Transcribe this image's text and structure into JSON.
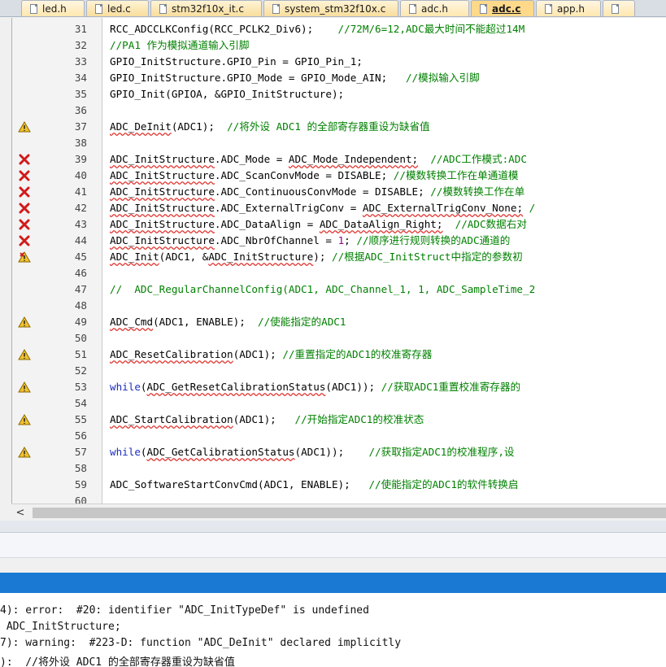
{
  "tabs": [
    {
      "label": "led.h",
      "kind": "header"
    },
    {
      "label": "led.c",
      "kind": "source"
    },
    {
      "label": "stm32f10x_it.c",
      "kind": "source"
    },
    {
      "label": "system_stm32f10x.c",
      "kind": "source"
    },
    {
      "label": "adc.h",
      "kind": "header"
    },
    {
      "label": "adc.c",
      "kind": "active"
    },
    {
      "label": "app.h",
      "kind": "header"
    },
    {
      "label": "",
      "kind": "header"
    }
  ],
  "editor": {
    "lines": [
      {
        "n": "31",
        "m": "",
        "segs": [
          [
            "RCC_ADCCLKConfig(RCC_PCLK2_Div6);    ",
            ""
          ],
          [
            "//72M/6=12,ADC最大时间不能超过14M",
            "cm"
          ]
        ]
      },
      {
        "n": "32",
        "m": "",
        "segs": [
          [
            "//PA1 作为模拟通道输入引脚",
            "cm"
          ]
        ]
      },
      {
        "n": "33",
        "m": "",
        "segs": [
          [
            "GPIO_InitStructure.GPIO_Pin = GPIO_Pin_1;",
            ""
          ]
        ]
      },
      {
        "n": "34",
        "m": "",
        "segs": [
          [
            "GPIO_InitStructure.GPIO_Mode = GPIO_Mode_AIN;   ",
            ""
          ],
          [
            "//模拟输入引脚",
            "cm"
          ]
        ]
      },
      {
        "n": "35",
        "m": "",
        "segs": [
          [
            "GPIO_Init(GPIOA, &GPIO_InitStructure);",
            ""
          ]
        ]
      },
      {
        "n": "36",
        "m": "",
        "segs": []
      },
      {
        "n": "37",
        "m": "warning",
        "segs": [
          [
            "ADC_DeInit",
            "sq"
          ],
          [
            "(ADC1);  ",
            ""
          ],
          [
            "//将外设 ADC1 的全部寄存器重设为缺省值",
            "cm"
          ]
        ]
      },
      {
        "n": "38",
        "m": "",
        "segs": []
      },
      {
        "n": "39",
        "m": "error",
        "segs": [
          [
            "ADC_InitStructure",
            "sq"
          ],
          [
            ".ADC_Mode = ",
            ""
          ],
          [
            "ADC_Mode_Independent;",
            "sq"
          ],
          [
            "  ",
            ""
          ],
          [
            "//ADC工作模式:ADC",
            "cm"
          ]
        ]
      },
      {
        "n": "40",
        "m": "error",
        "segs": [
          [
            "ADC_InitStructure",
            "sq"
          ],
          [
            ".ADC_ScanConvMode = DISABLE; ",
            ""
          ],
          [
            "//模数转换工作在单通道模",
            "cm"
          ]
        ]
      },
      {
        "n": "41",
        "m": "error",
        "segs": [
          [
            "ADC_InitStructure",
            "sq"
          ],
          [
            ".ADC_ContinuousConvMode = DISABLE; ",
            ""
          ],
          [
            "//模数转换工作在单",
            "cm"
          ]
        ]
      },
      {
        "n": "42",
        "m": "error",
        "segs": [
          [
            "ADC_InitStructure",
            "sq"
          ],
          [
            ".ADC_ExternalTrigConv = ",
            ""
          ],
          [
            "ADC_ExternalTrigConv_None;",
            "sq"
          ],
          [
            " /",
            "cm"
          ]
        ]
      },
      {
        "n": "43",
        "m": "error",
        "segs": [
          [
            "ADC_InitStructure",
            "sq"
          ],
          [
            ".ADC_DataAlign = ",
            ""
          ],
          [
            "ADC_DataAlign_Right;",
            "sq"
          ],
          [
            "  ",
            ""
          ],
          [
            "//ADC数据右对",
            "cm"
          ]
        ]
      },
      {
        "n": "44",
        "m": "error",
        "segs": [
          [
            "ADC_InitStructure",
            "sq"
          ],
          [
            ".ADC_NbrOfChannel = ",
            ""
          ],
          [
            "1",
            "num"
          ],
          [
            "; ",
            ""
          ],
          [
            "//顺序进行规则转换的ADC通道的",
            "cm"
          ]
        ]
      },
      {
        "n": "45",
        "m": "warnerror",
        "segs": [
          [
            "ADC_Init",
            "sq"
          ],
          [
            "(ADC1, &",
            ""
          ],
          [
            "ADC_InitStructure",
            "sq"
          ],
          [
            "); ",
            ""
          ],
          [
            "//根据ADC_InitStruct中指定的参数初",
            "cm"
          ]
        ]
      },
      {
        "n": "46",
        "m": "",
        "segs": []
      },
      {
        "n": "47",
        "m": "",
        "segs": [
          [
            "//  ADC_RegularChannelConfig(ADC1, ADC_Channel_1, 1, ADC_SampleTime_2",
            "cm"
          ]
        ]
      },
      {
        "n": "48",
        "m": "",
        "segs": []
      },
      {
        "n": "49",
        "m": "warning",
        "segs": [
          [
            "ADC_Cmd",
            "sq"
          ],
          [
            "(ADC1, ENABLE);  ",
            ""
          ],
          [
            "//使能指定的ADC1",
            "cm"
          ]
        ]
      },
      {
        "n": "50",
        "m": "",
        "segs": []
      },
      {
        "n": "51",
        "m": "warning",
        "segs": [
          [
            "ADC_ResetCalibration",
            "sq"
          ],
          [
            "(ADC1); ",
            ""
          ],
          [
            "//重置指定的ADC1的校准寄存器",
            "cm"
          ]
        ]
      },
      {
        "n": "52",
        "m": "",
        "segs": []
      },
      {
        "n": "53",
        "m": "warning",
        "segs": [
          [
            "while",
            "kw"
          ],
          [
            "(",
            ""
          ],
          [
            "ADC_GetResetCalibrationStatus",
            "sq"
          ],
          [
            "(ADC1)); ",
            ""
          ],
          [
            "//获取ADC1重置校准寄存器的",
            "cm"
          ]
        ]
      },
      {
        "n": "54",
        "m": "",
        "segs": []
      },
      {
        "n": "55",
        "m": "warning",
        "segs": [
          [
            "ADC_StartCalibration",
            "sq"
          ],
          [
            "(ADC1);   ",
            ""
          ],
          [
            "//开始指定ADC1的校准状态",
            "cm"
          ]
        ]
      },
      {
        "n": "56",
        "m": "",
        "segs": []
      },
      {
        "n": "57",
        "m": "warning",
        "segs": [
          [
            "while",
            "kw"
          ],
          [
            "(",
            ""
          ],
          [
            "ADC_GetCalibrationStatus",
            "sq"
          ],
          [
            "(ADC1));    ",
            ""
          ],
          [
            "//获取指定ADC1的校准程序,设",
            "cm"
          ]
        ]
      },
      {
        "n": "58",
        "m": "",
        "segs": []
      },
      {
        "n": "59",
        "m": "",
        "segs": [
          [
            "ADC_SoftwareStartConvCmd(ADC1, ENABLE);   ",
            ""
          ],
          [
            "//使能指定的ADC1的软件转换启",
            "cm"
          ]
        ]
      },
      {
        "n": "60",
        "m": "",
        "segs": []
      }
    ]
  },
  "scrollbar": {
    "left_arrow": "<"
  },
  "build_output": {
    "lines": [
      "4): error:  #20: identifier \"ADC_InitTypeDef\" is undefined",
      " ADC_InitStructure;",
      "7): warning:  #223-D: function \"ADC_DeInit\" declared implicitly",
      "):  //将外设 ADC1 的全部寄存器重设为缺省值"
    ]
  },
  "colors": {
    "comment": "#008000",
    "keyword": "#1c2fbf",
    "squiggle": "#e0342f",
    "build_title": "#1979d3",
    "active_tab": "#ffd98a"
  }
}
